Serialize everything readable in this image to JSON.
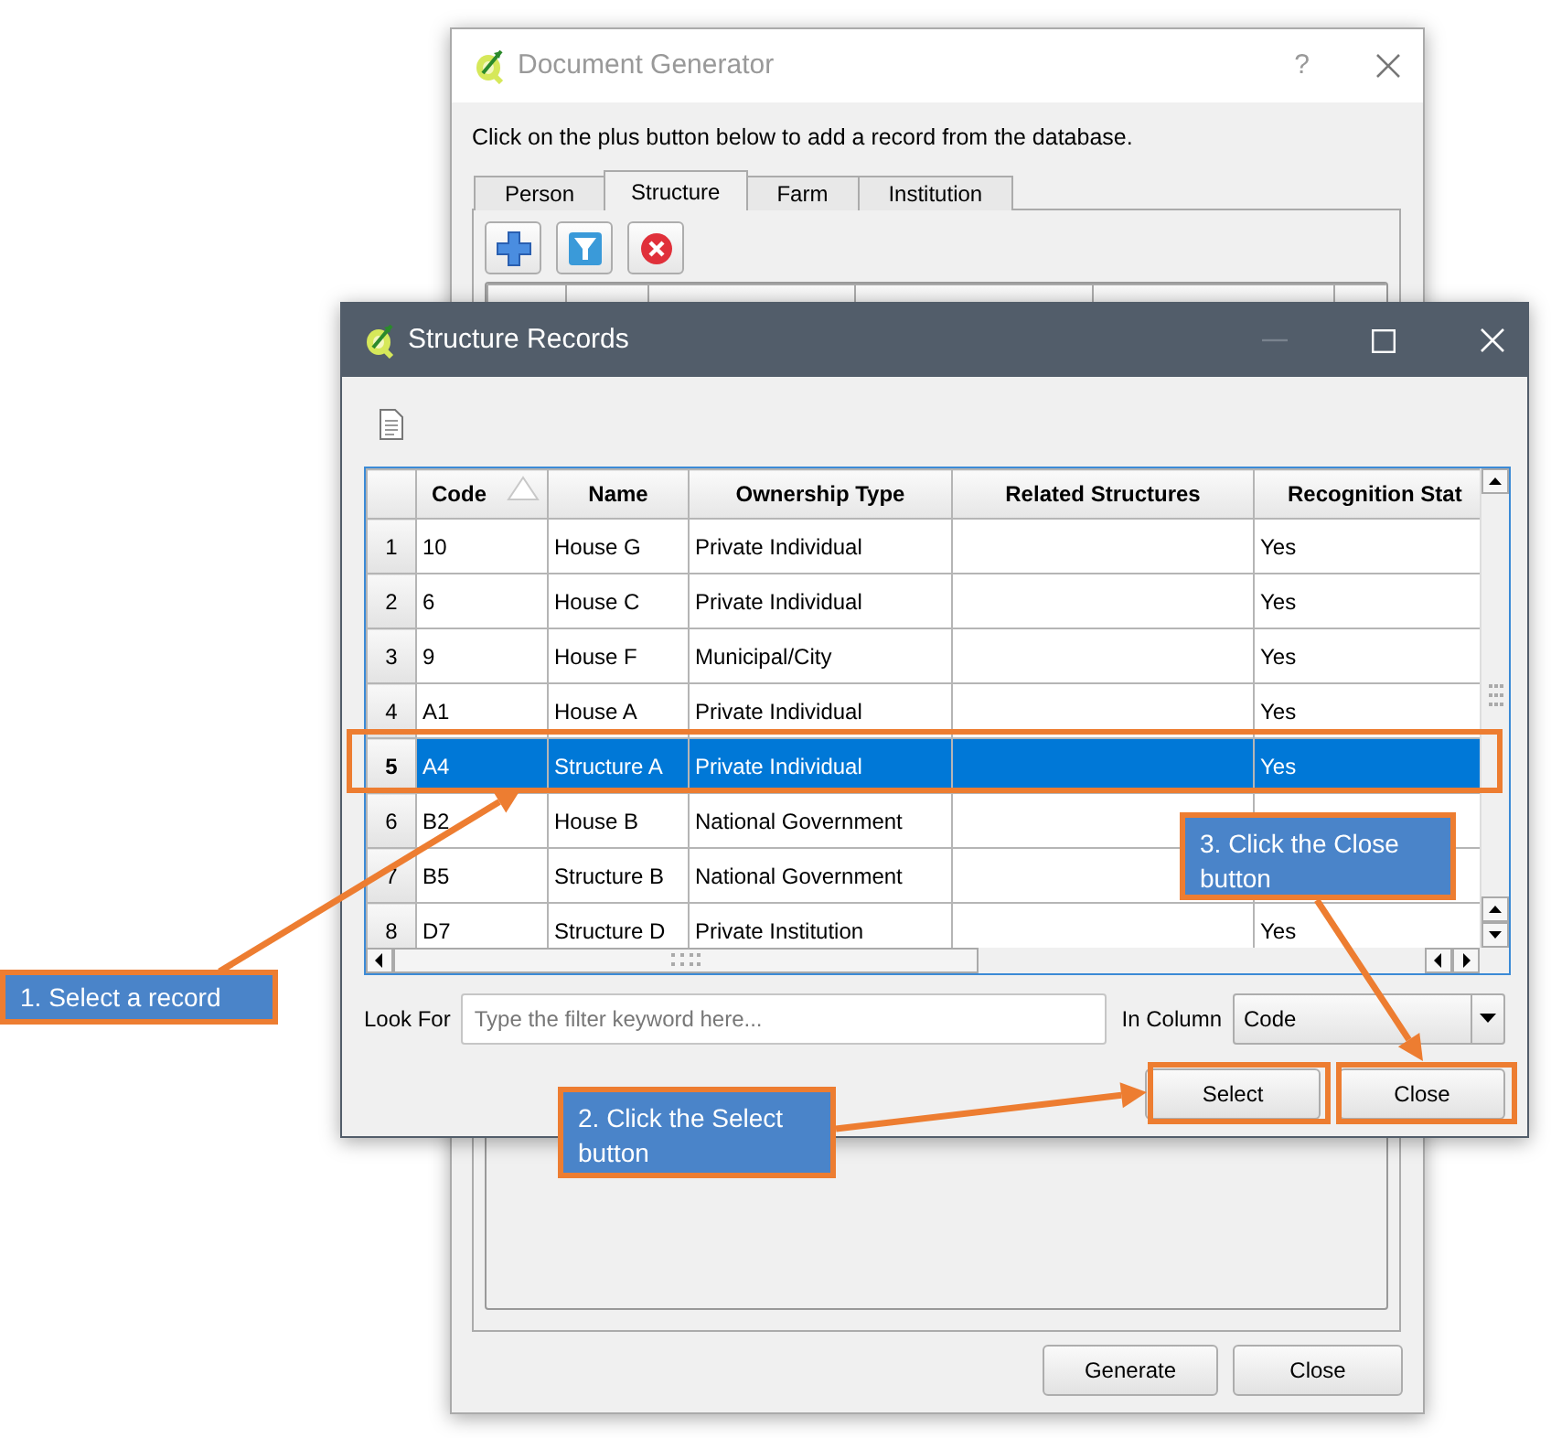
{
  "document_generator": {
    "title": "Document Generator",
    "help": "?",
    "instruction": "Click on the plus button below to add a record from the database.",
    "tabs": [
      {
        "label": "Person",
        "selected": false
      },
      {
        "label": "Structure",
        "selected": true
      },
      {
        "label": "Farm",
        "selected": false
      },
      {
        "label": "Institution",
        "selected": false
      }
    ],
    "buttons": [
      "Generate",
      "Close"
    ]
  },
  "structure_records": {
    "title": "Structure Records",
    "columns": [
      {
        "label": "Code",
        "sorted": true
      },
      {
        "label": "Name",
        "sorted": false
      },
      {
        "label": "Ownership Type",
        "sorted": false
      },
      {
        "label": "Related Structures",
        "sorted": false
      },
      {
        "label": "Recognition Stat",
        "sorted": false
      }
    ],
    "rows": [
      {
        "number": "1",
        "cells": [
          "10",
          "House G",
          "Private Individual",
          "",
          "Yes"
        ],
        "selected": false
      },
      {
        "number": "2",
        "cells": [
          "6",
          "House C",
          "Private Individual",
          "",
          "Yes"
        ],
        "selected": false
      },
      {
        "number": "3",
        "cells": [
          "9",
          "House F",
          "Municipal/City",
          "",
          "Yes"
        ],
        "selected": false
      },
      {
        "number": "4",
        "cells": [
          "A1",
          "House A",
          "Private Individual",
          "",
          "Yes"
        ],
        "selected": false
      },
      {
        "number": "5",
        "cells": [
          "A4",
          "Structure A",
          "Private Individual",
          "",
          "Yes"
        ],
        "selected": true
      },
      {
        "number": "6",
        "cells": [
          "B2",
          "House B",
          "National Government",
          "",
          ""
        ],
        "selected": false
      },
      {
        "number": "7",
        "cells": [
          "B5",
          "Structure B",
          "National Government",
          "",
          ""
        ],
        "selected": false
      },
      {
        "number": "8",
        "cells": [
          "D7",
          "Structure D",
          "Private Institution",
          "",
          "Yes"
        ],
        "selected": false
      }
    ],
    "look_for_label": "Look For",
    "look_for_placeholder": "Type the filter keyword here...",
    "in_column_label": "In Column",
    "in_column_value": "Code",
    "buttons": [
      "Select",
      "Close"
    ]
  },
  "callouts": [
    "1. Select a record",
    "2. Click the Select button",
    "3. Click the Close button"
  ]
}
